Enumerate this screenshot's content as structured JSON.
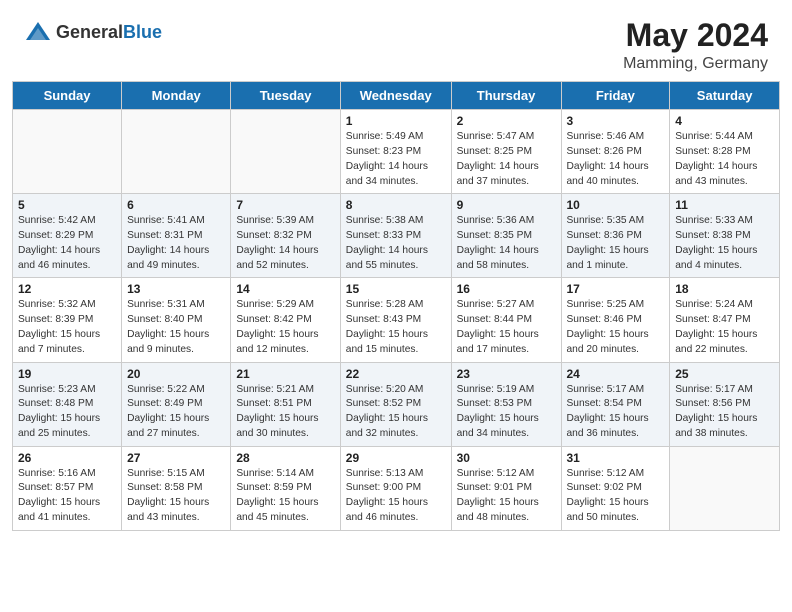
{
  "header": {
    "logo_general": "General",
    "logo_blue": "Blue",
    "month_year": "May 2024",
    "location": "Mamming, Germany"
  },
  "days_of_week": [
    "Sunday",
    "Monday",
    "Tuesday",
    "Wednesday",
    "Thursday",
    "Friday",
    "Saturday"
  ],
  "weeks": [
    [
      {
        "day": "",
        "info": ""
      },
      {
        "day": "",
        "info": ""
      },
      {
        "day": "",
        "info": ""
      },
      {
        "day": "1",
        "info": "Sunrise: 5:49 AM\nSunset: 8:23 PM\nDaylight: 14 hours\nand 34 minutes."
      },
      {
        "day": "2",
        "info": "Sunrise: 5:47 AM\nSunset: 8:25 PM\nDaylight: 14 hours\nand 37 minutes."
      },
      {
        "day": "3",
        "info": "Sunrise: 5:46 AM\nSunset: 8:26 PM\nDaylight: 14 hours\nand 40 minutes."
      },
      {
        "day": "4",
        "info": "Sunrise: 5:44 AM\nSunset: 8:28 PM\nDaylight: 14 hours\nand 43 minutes."
      }
    ],
    [
      {
        "day": "5",
        "info": "Sunrise: 5:42 AM\nSunset: 8:29 PM\nDaylight: 14 hours\nand 46 minutes."
      },
      {
        "day": "6",
        "info": "Sunrise: 5:41 AM\nSunset: 8:31 PM\nDaylight: 14 hours\nand 49 minutes."
      },
      {
        "day": "7",
        "info": "Sunrise: 5:39 AM\nSunset: 8:32 PM\nDaylight: 14 hours\nand 52 minutes."
      },
      {
        "day": "8",
        "info": "Sunrise: 5:38 AM\nSunset: 8:33 PM\nDaylight: 14 hours\nand 55 minutes."
      },
      {
        "day": "9",
        "info": "Sunrise: 5:36 AM\nSunset: 8:35 PM\nDaylight: 14 hours\nand 58 minutes."
      },
      {
        "day": "10",
        "info": "Sunrise: 5:35 AM\nSunset: 8:36 PM\nDaylight: 15 hours\nand 1 minute."
      },
      {
        "day": "11",
        "info": "Sunrise: 5:33 AM\nSunset: 8:38 PM\nDaylight: 15 hours\nand 4 minutes."
      }
    ],
    [
      {
        "day": "12",
        "info": "Sunrise: 5:32 AM\nSunset: 8:39 PM\nDaylight: 15 hours\nand 7 minutes."
      },
      {
        "day": "13",
        "info": "Sunrise: 5:31 AM\nSunset: 8:40 PM\nDaylight: 15 hours\nand 9 minutes."
      },
      {
        "day": "14",
        "info": "Sunrise: 5:29 AM\nSunset: 8:42 PM\nDaylight: 15 hours\nand 12 minutes."
      },
      {
        "day": "15",
        "info": "Sunrise: 5:28 AM\nSunset: 8:43 PM\nDaylight: 15 hours\nand 15 minutes."
      },
      {
        "day": "16",
        "info": "Sunrise: 5:27 AM\nSunset: 8:44 PM\nDaylight: 15 hours\nand 17 minutes."
      },
      {
        "day": "17",
        "info": "Sunrise: 5:25 AM\nSunset: 8:46 PM\nDaylight: 15 hours\nand 20 minutes."
      },
      {
        "day": "18",
        "info": "Sunrise: 5:24 AM\nSunset: 8:47 PM\nDaylight: 15 hours\nand 22 minutes."
      }
    ],
    [
      {
        "day": "19",
        "info": "Sunrise: 5:23 AM\nSunset: 8:48 PM\nDaylight: 15 hours\nand 25 minutes."
      },
      {
        "day": "20",
        "info": "Sunrise: 5:22 AM\nSunset: 8:49 PM\nDaylight: 15 hours\nand 27 minutes."
      },
      {
        "day": "21",
        "info": "Sunrise: 5:21 AM\nSunset: 8:51 PM\nDaylight: 15 hours\nand 30 minutes."
      },
      {
        "day": "22",
        "info": "Sunrise: 5:20 AM\nSunset: 8:52 PM\nDaylight: 15 hours\nand 32 minutes."
      },
      {
        "day": "23",
        "info": "Sunrise: 5:19 AM\nSunset: 8:53 PM\nDaylight: 15 hours\nand 34 minutes."
      },
      {
        "day": "24",
        "info": "Sunrise: 5:17 AM\nSunset: 8:54 PM\nDaylight: 15 hours\nand 36 minutes."
      },
      {
        "day": "25",
        "info": "Sunrise: 5:17 AM\nSunset: 8:56 PM\nDaylight: 15 hours\nand 38 minutes."
      }
    ],
    [
      {
        "day": "26",
        "info": "Sunrise: 5:16 AM\nSunset: 8:57 PM\nDaylight: 15 hours\nand 41 minutes."
      },
      {
        "day": "27",
        "info": "Sunrise: 5:15 AM\nSunset: 8:58 PM\nDaylight: 15 hours\nand 43 minutes."
      },
      {
        "day": "28",
        "info": "Sunrise: 5:14 AM\nSunset: 8:59 PM\nDaylight: 15 hours\nand 45 minutes."
      },
      {
        "day": "29",
        "info": "Sunrise: 5:13 AM\nSunset: 9:00 PM\nDaylight: 15 hours\nand 46 minutes."
      },
      {
        "day": "30",
        "info": "Sunrise: 5:12 AM\nSunset: 9:01 PM\nDaylight: 15 hours\nand 48 minutes."
      },
      {
        "day": "31",
        "info": "Sunrise: 5:12 AM\nSunset: 9:02 PM\nDaylight: 15 hours\nand 50 minutes."
      },
      {
        "day": "",
        "info": ""
      }
    ]
  ]
}
